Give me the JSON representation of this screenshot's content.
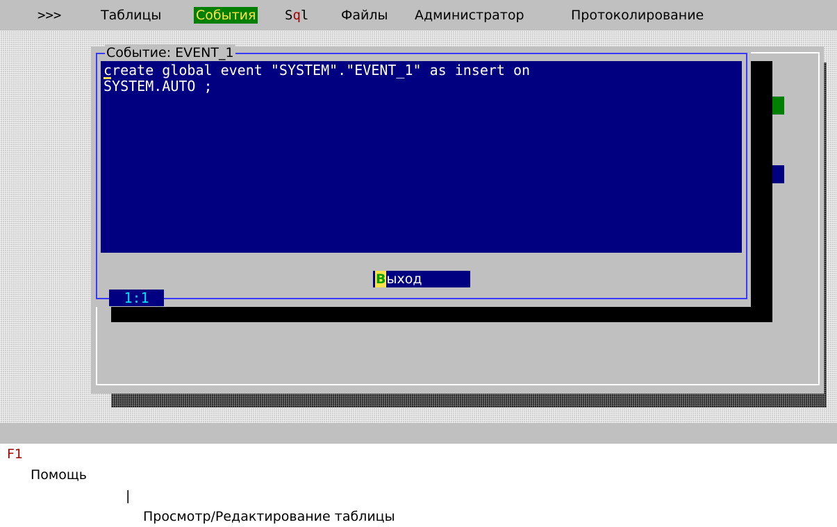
{
  "menu": {
    "items": [
      {
        "label": ">>>"
      },
      {
        "label": "Таблицы"
      },
      {
        "label": "События",
        "active": true
      },
      {
        "label_pre": "S",
        "label_hot": "q",
        "label_post": "l"
      },
      {
        "label": "Файлы"
      },
      {
        "label": "Администратор"
      },
      {
        "label": "Протоколирование"
      }
    ]
  },
  "dialog": {
    "title": "Событие: EVENT_1",
    "editor_text": "create global event \"SYSTEM\".\"EVENT_1\" as insert on\nSYSTEM.AUTO ;",
    "exit_button": {
      "hotkey": "В",
      "rest": "ыход"
    },
    "cursor_position": "1:1"
  },
  "statusbar": {
    "key": "F1",
    "help": "Помощь",
    "separator": "|",
    "message": "Просмотр/Редактирование таблицы"
  },
  "colors": {
    "menu_active_bg": "#008000",
    "menu_active_fg": "#ffe14a",
    "editor_bg": "#000080",
    "frame_border": "#3838ff",
    "hotkey": "#a00000"
  }
}
